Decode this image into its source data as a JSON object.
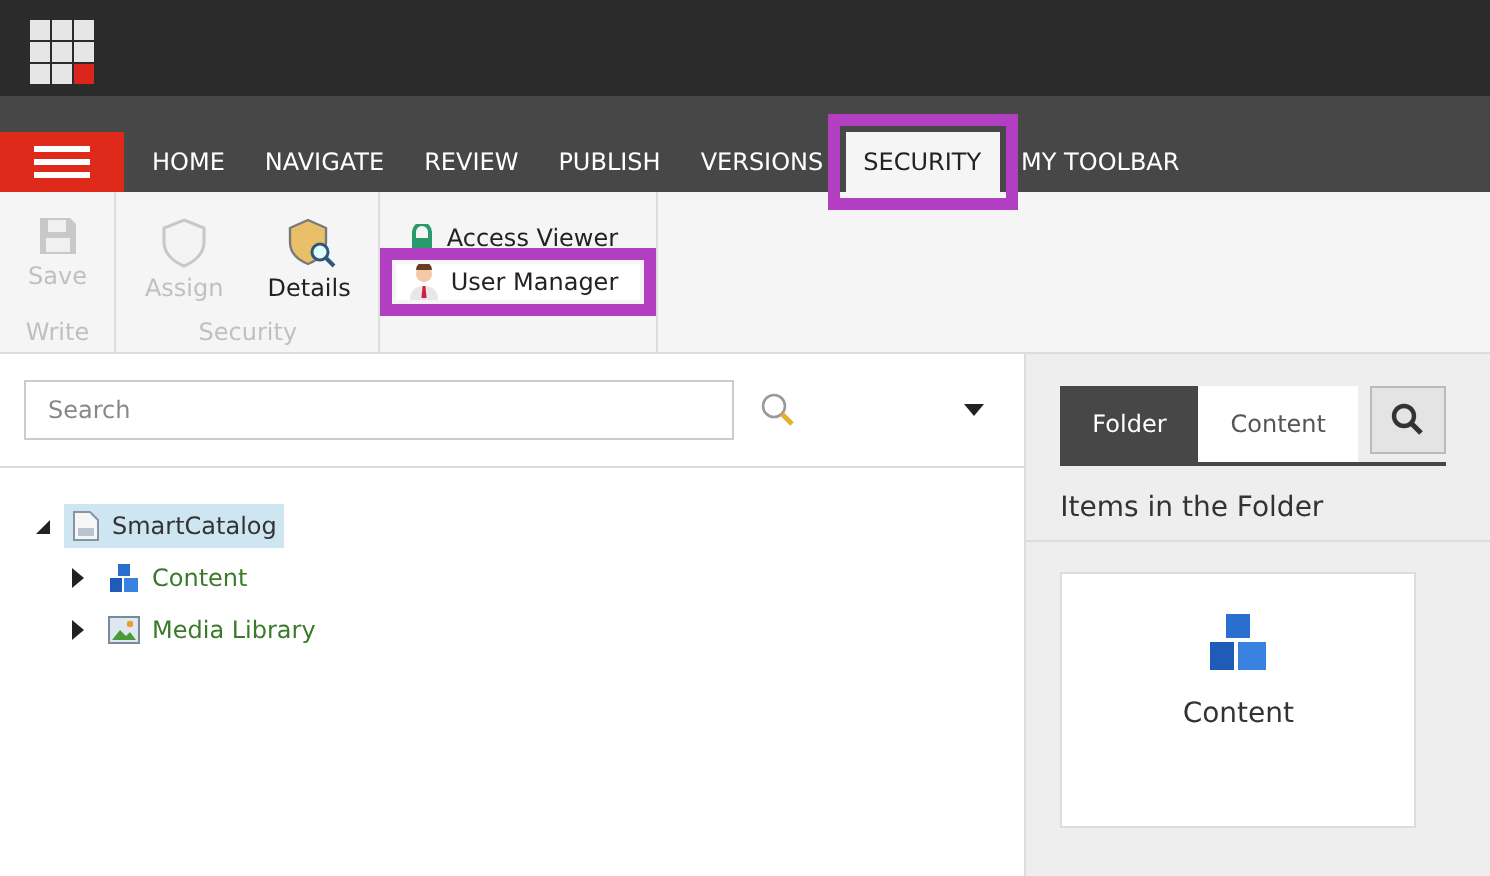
{
  "nav": {
    "tabs": [
      {
        "label": "HOME",
        "selected": false,
        "highlighted": false
      },
      {
        "label": "NAVIGATE",
        "selected": false,
        "highlighted": false
      },
      {
        "label": "REVIEW",
        "selected": false,
        "highlighted": false
      },
      {
        "label": "PUBLISH",
        "selected": false,
        "highlighted": false
      },
      {
        "label": "VERSIONS",
        "selected": false,
        "highlighted": false
      },
      {
        "label": "SECURITY",
        "selected": true,
        "highlighted": true
      },
      {
        "label": "MY TOOLBAR",
        "selected": false,
        "highlighted": false
      }
    ]
  },
  "ribbon": {
    "groups": [
      {
        "label": "Write",
        "kind": "large",
        "items": [
          {
            "label": "Save",
            "disabled": true
          }
        ]
      },
      {
        "label": "Security",
        "kind": "large",
        "items": [
          {
            "label": "Assign",
            "disabled": true
          },
          {
            "label": "Details",
            "disabled": false
          }
        ]
      },
      {
        "kind": "small",
        "items": [
          {
            "label": "Access Viewer",
            "disabled": false,
            "highlighted": false
          },
          {
            "label": "User Manager",
            "disabled": false,
            "highlighted": true
          }
        ]
      }
    ]
  },
  "search": {
    "placeholder": "Search"
  },
  "tree": [
    {
      "label": "SmartCatalog",
      "expanded": true,
      "selected": true,
      "children": [
        {
          "label": "Content",
          "expanded": false,
          "selected": false
        },
        {
          "label": "Media Library",
          "expanded": false,
          "selected": false
        }
      ]
    }
  ],
  "folder_panel": {
    "tabs": [
      {
        "label": "Folder",
        "selected": true
      },
      {
        "label": "Content",
        "selected": false
      }
    ],
    "heading": "Items in the Folder",
    "items": [
      {
        "label": "Content"
      }
    ]
  }
}
